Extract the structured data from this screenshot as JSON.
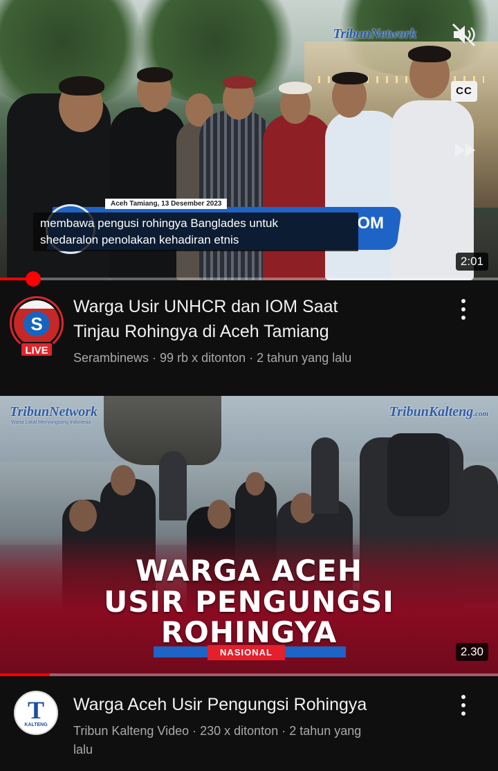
{
  "video1": {
    "watermark": "TribunNetwork",
    "caption_line1": "membawa pengusi rohingya Banglades untuk",
    "caption_line2": "shedaralon penolakan kehadiran etnis",
    "lower_third_date": "Aceh Tamiang, 13 Desember 2023",
    "lower_third_visible": "OM",
    "cc_label": "CC",
    "duration": "2:01",
    "progress_fraction": 0.067,
    "channel_badge": "LIVE",
    "channel_letter": "S",
    "title_line1": "Warga Usir UNHCR dan IOM Saat",
    "title_line2": "Tinjau Rohingya di Aceh Tamiang",
    "subtitle": "Serambinews · 99 rb x ditonton · 2 tahun yang lalu"
  },
  "video2": {
    "watermark_left": "TribunNetwork",
    "watermark_left_tagline": "Warta Lokal Menyongsong Indonesia",
    "watermark_right": "TribunKalteng",
    "watermark_right_suffix": ".com",
    "headline_line1": "WARGA ACEH",
    "headline_line2": "USIR PENGUNGSI",
    "headline_line3": "ROHINGYA",
    "tag": "NASIONAL",
    "duration": "2.30",
    "progress_fraction": 0.1,
    "channel_avatar_letter": "T",
    "channel_avatar_text": "KALTENG",
    "title": "Warga Aceh Usir Pengungsi Rohingya",
    "subtitle_line1": "Tribun Kalteng Video · 230 x ditonton · 2 tahun yang",
    "subtitle_line2": "lalu"
  },
  "colors": {
    "background": "#0f0f0f",
    "accent_red": "#ff0000",
    "secondary_text": "#aaaaaa",
    "tribun_blue": "#1e63c6"
  },
  "icons": [
    "mute-icon",
    "closed-captions-icon",
    "fast-forward-icon",
    "more-vert-icon"
  ]
}
